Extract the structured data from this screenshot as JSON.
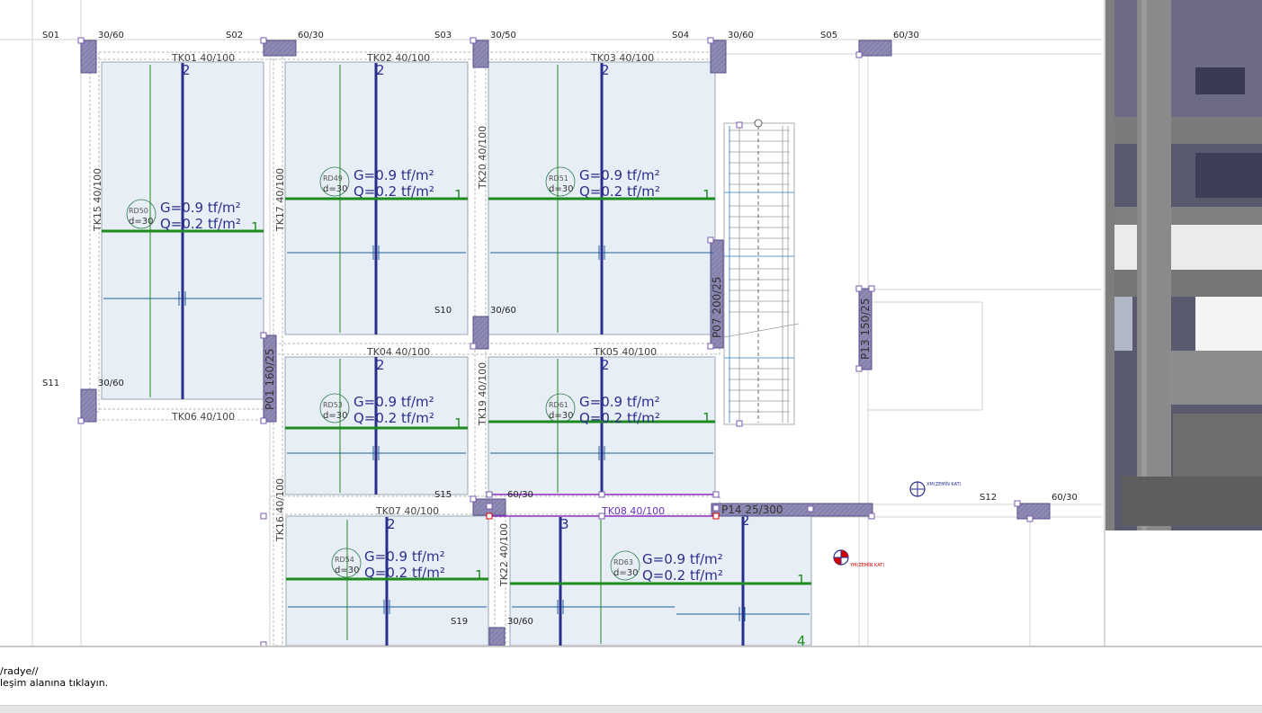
{
  "command_line": {
    "line1": "/radye//",
    "line2": "leşim alanına tıklayın."
  },
  "columns": [
    {
      "id": "S01",
      "size": "30/60"
    },
    {
      "id": "S02",
      "size": "60/30"
    },
    {
      "id": "S03",
      "size": "30/50"
    },
    {
      "id": "S04",
      "size": "30/60"
    },
    {
      "id": "S05",
      "size": "60/30"
    },
    {
      "id": "S10",
      "size": "30/60"
    },
    {
      "id": "S11",
      "size": "30/60"
    },
    {
      "id": "S12",
      "size": "60/30"
    },
    {
      "id": "S15",
      "size": "60/30"
    },
    {
      "id": "S19",
      "size": "30/60"
    }
  ],
  "beams": {
    "tk01": "TK01 40/100",
    "tk02": "TK02 40/100",
    "tk03": "TK03 40/100",
    "tk04": "TK04 40/100",
    "tk05": "TK05 40/100",
    "tk06": "TK06 40/100",
    "tk07": "TK07 40/100",
    "tk08": "TK08 40/100",
    "tk15": "TK15 40/100",
    "tk16": "TK16 40/100",
    "tk17": "TK17 40/100",
    "tk19": "TK19 40/100",
    "tk20": "TK20 40/100",
    "tk22": "TK22 40/100"
  },
  "walls": {
    "p01": "P01 160/25",
    "p07": "P07 200/25",
    "p13": "P13 150/25",
    "p14": "P14 25/300"
  },
  "slabs": [
    {
      "id": "RD50",
      "thk": "d=30",
      "g": "G=0.9 tf/m²",
      "q": "Q=0.2 tf/m²"
    },
    {
      "id": "RD49",
      "thk": "d=30",
      "g": "G=0.9 tf/m²",
      "q": "Q=0.2 tf/m²"
    },
    {
      "id": "RD51",
      "thk": "d=30",
      "g": "G=0.9 tf/m²",
      "q": "Q=0.2 tf/m²"
    },
    {
      "id": "RD53",
      "thk": "d=30",
      "g": "G=0.9 tf/m²",
      "q": "Q=0.2 tf/m²"
    },
    {
      "id": "RD61",
      "thk": "d=30",
      "g": "G=0.9 tf/m²",
      "q": "Q=0.2 tf/m²"
    },
    {
      "id": "RD54",
      "thk": "d=30",
      "g": "G=0.9 tf/m²",
      "q": "Q=0.2 tf/m²"
    },
    {
      "id": "RD63",
      "thk": "d=30",
      "g": "G=0.9 tf/m²",
      "q": "Q=0.2 tf/m²"
    }
  ],
  "markers": {
    "m1": "XM(ZEMİN KAT)",
    "m2": "YM(ZEMİN KAT)"
  },
  "colors": {
    "slab_fill": "#e8eef6",
    "slab_stroke": "#9aa6b4",
    "direction_line": "#2a2f8c",
    "green_line": "#1f8a1f",
    "column_fill": "#8a86b2",
    "text": "#444444",
    "accent_red": "#d40000"
  }
}
